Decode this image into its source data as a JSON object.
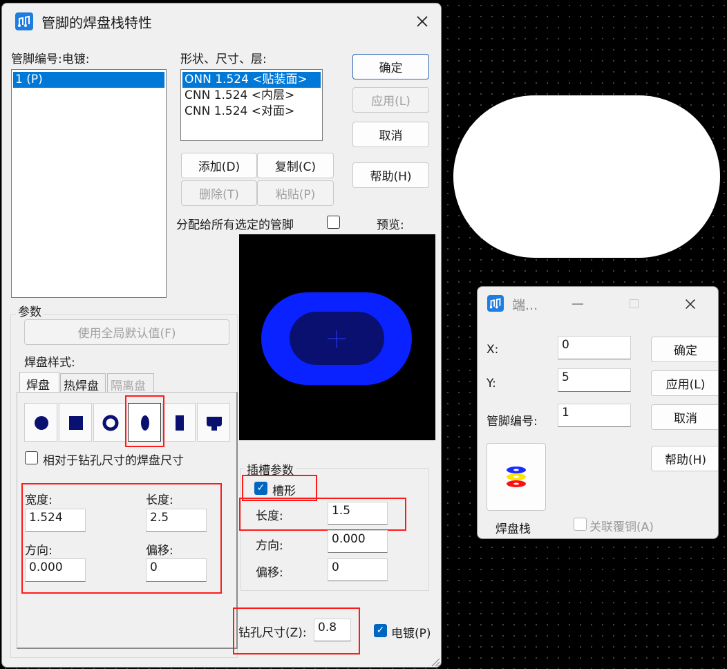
{
  "main": {
    "title": "管脚的焊盘栈特性",
    "pins_label": "管脚编号:电镀:",
    "pins": [
      "1 (P)"
    ],
    "shapes_label": "形状、尺寸、层:",
    "layers": [
      "ONN 1.524 <贴装面>",
      "CNN 1.524 <内层>",
      "CNN 1.524 <对面>"
    ],
    "ok": "确定",
    "apply": "应用(L)",
    "cancel": "取消",
    "help": "帮助(H)",
    "add": "添加(D)",
    "copy": "复制(C)",
    "delete": "删除(T)",
    "paste": "粘贴(P)",
    "assign_all": "分配给所有选定的管脚",
    "preview": "预览:",
    "params": "参数",
    "use_global": "使用全局默认值(F)",
    "pad_style": "焊盘样式:",
    "tabs": [
      "焊盘",
      "热焊盘",
      "隔离盘"
    ],
    "relative_drill": "相对于钻孔尺寸的焊盘尺寸",
    "width_label": "宽度:",
    "width": "1.524",
    "length_label": "长度:",
    "length": "2.5",
    "orient_label": "方向:",
    "orient": "0.000",
    "offset_label": "偏移:",
    "offset": "0",
    "slot_group": "插槽参数",
    "slotted": "槽形",
    "slot_length_label": "长度:",
    "slot_length": "1.5",
    "slot_orient_label": "方向:",
    "slot_orient": "0.000",
    "slot_offset_label": "偏移:",
    "slot_offset": "0",
    "drill_label": "钻孔尺寸(Z):",
    "drill": "0.8",
    "plated": "电镀(P)"
  },
  "terminal": {
    "title": "端...",
    "x_label": "X:",
    "x": "0",
    "y_label": "Y:",
    "y": "5",
    "pin_label": "管脚编号:",
    "pin": "1",
    "ok": "确定",
    "apply": "应用(L)",
    "cancel": "取消",
    "help": "帮助(H)",
    "padstack": "焊盘栈",
    "assoc_copper": "关联覆铜(A)"
  },
  "colors": {
    "pad_blue": "#0a22ff",
    "drill_dark": "#0a1070",
    "accent": "#0078d7",
    "highlight": "#ff1a1a"
  }
}
